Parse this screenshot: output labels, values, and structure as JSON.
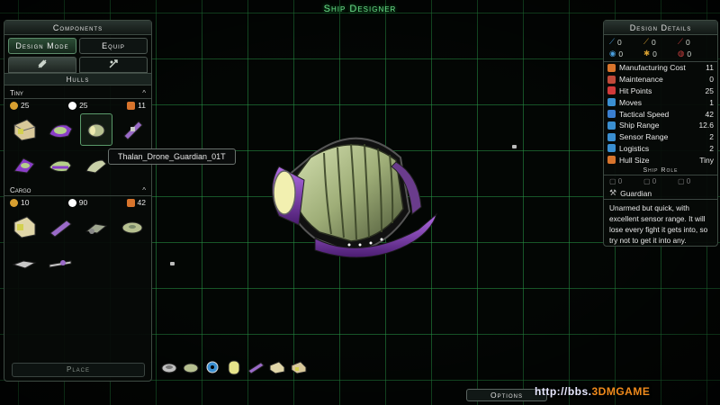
{
  "screen_title": "Ship Designer",
  "left_panel": {
    "title": "Components",
    "mode_tabs": [
      {
        "label": "Design Mode",
        "active": true
      },
      {
        "label": "Equip",
        "active": false
      }
    ],
    "icon_tabs": [
      {
        "icon": "hull-category-icon",
        "active": true
      },
      {
        "icon": "component-category-icon",
        "active": false
      }
    ],
    "hulls_header": "Hulls",
    "sections": [
      {
        "name": "Tiny",
        "resources": [
          "25",
          "25",
          "11"
        ],
        "hull_count": 7
      },
      {
        "name": "Cargo",
        "resources": [
          "10",
          "90",
          "42"
        ],
        "hull_count": 6
      }
    ],
    "place_label": "Place"
  },
  "tooltip": "Thalan_Drone_Guardian_01T",
  "design_details": {
    "title": "Design Details",
    "attack_defense": [
      "0",
      "0",
      "0",
      "0",
      "0",
      "0"
    ],
    "stats": [
      {
        "label": "Manufacturing Cost",
        "value": "11",
        "icon": "manufacturing-icon",
        "color": "#d8742c"
      },
      {
        "label": "Maintenance",
        "value": "0",
        "icon": "maintenance-icon",
        "color": "#c04a3a"
      },
      {
        "label": "Hit Points",
        "value": "25",
        "icon": "hit-points-icon",
        "color": "#d13a3a"
      },
      {
        "label": "Moves",
        "value": "1",
        "icon": "moves-icon",
        "color": "#3a8fd1"
      },
      {
        "label": "Tactical Speed",
        "value": "42",
        "icon": "tactical-speed-icon",
        "color": "#3a7fd1"
      },
      {
        "label": "Ship Range",
        "value": "12.6",
        "icon": "ship-range-icon",
        "color": "#3a8fd1"
      },
      {
        "label": "Sensor Range",
        "value": "2",
        "icon": "sensor-range-icon",
        "color": "#3a8fd1"
      },
      {
        "label": "Logistics",
        "value": "2",
        "icon": "logistics-icon",
        "color": "#3a8fd1"
      },
      {
        "label": "Hull Size",
        "value": "Tiny",
        "icon": "hull-size-icon",
        "color": "#d8742c"
      }
    ],
    "ship_role_header": "Ship Role",
    "role_counts": [
      "0",
      "0",
      "0"
    ],
    "role_name": "Guardian",
    "role_description": "Unarmed but quick, with excellent sensor range. It will lose every fight it gets into, so try not to get it into any."
  },
  "options_label": "Options",
  "watermark": {
    "url": "http://bbs.",
    "brand": "3DMGAME"
  },
  "colors": {
    "grid": "#28964a",
    "title_green": "#6be08a",
    "hull_purple": "#8a3ec8",
    "hull_green": "#b6d08a"
  }
}
